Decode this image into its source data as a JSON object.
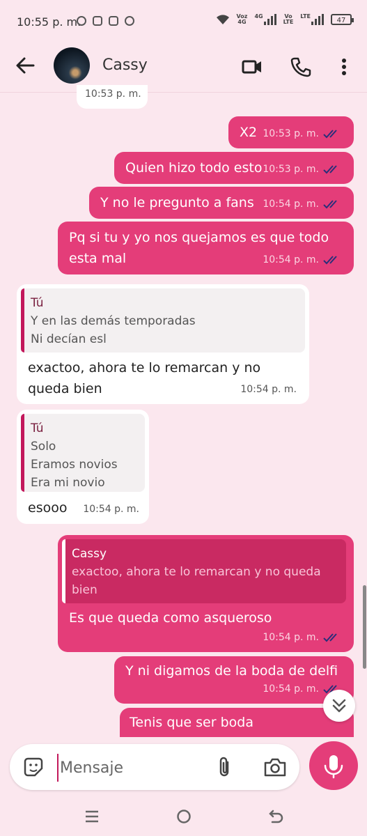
{
  "status_bar": {
    "time": "10:55 p. m.",
    "net1_top": "Voz",
    "net1_bottom": "4G",
    "net2_label": "4G",
    "net3_top": "Vo",
    "net3_bottom": "LTE",
    "net4_label": "LTE",
    "battery": "47"
  },
  "header": {
    "contact_name": "Cassy"
  },
  "messages": [
    {
      "time_partial": "10:53 p. m."
    },
    {
      "text": "X2",
      "time": "10:53 p. m."
    },
    {
      "text": "Quien hizo todo esto",
      "time": "10:53 p. m."
    },
    {
      "text": "Y no le pregunto a fans",
      "time": "10:54 p. m."
    },
    {
      "text_line1": "Pq si tu y yo nos quejamos es que todo",
      "text_line2": "esta mal",
      "time": "10:54 p. m."
    },
    {
      "quote_author": "Tú",
      "quote_line1": "Y en las demás temporadas",
      "quote_line2": "Ni decían esl",
      "text_line1": "exactoo, ahora te lo remarcan y no",
      "text_line2": "queda bien",
      "time": "10:54 p. m."
    },
    {
      "quote_author": "Tú",
      "quote_line1": "Solo",
      "quote_line2": "Eramos novios",
      "quote_line3": "Era mi novio",
      "text": "esooo",
      "time": "10:54 p. m."
    },
    {
      "quote_author": "Cassy",
      "quote_line1": "exactoo, ahora te lo remarcan y no queda",
      "quote_line2": "bien",
      "text": "Es que queda como asqueroso",
      "time": "10:54 p. m."
    },
    {
      "text": "Y ni digamos de la boda de delfi",
      "time": "10:54 p. m."
    },
    {
      "text": "Tenis que ser boda"
    }
  ],
  "composer": {
    "placeholder": "Mensaje"
  },
  "colors": {
    "background": "#fbe7ee",
    "outgoing_bubble": "#e43d79",
    "incoming_bubble": "#ffffff",
    "accent": "#c2185b"
  }
}
